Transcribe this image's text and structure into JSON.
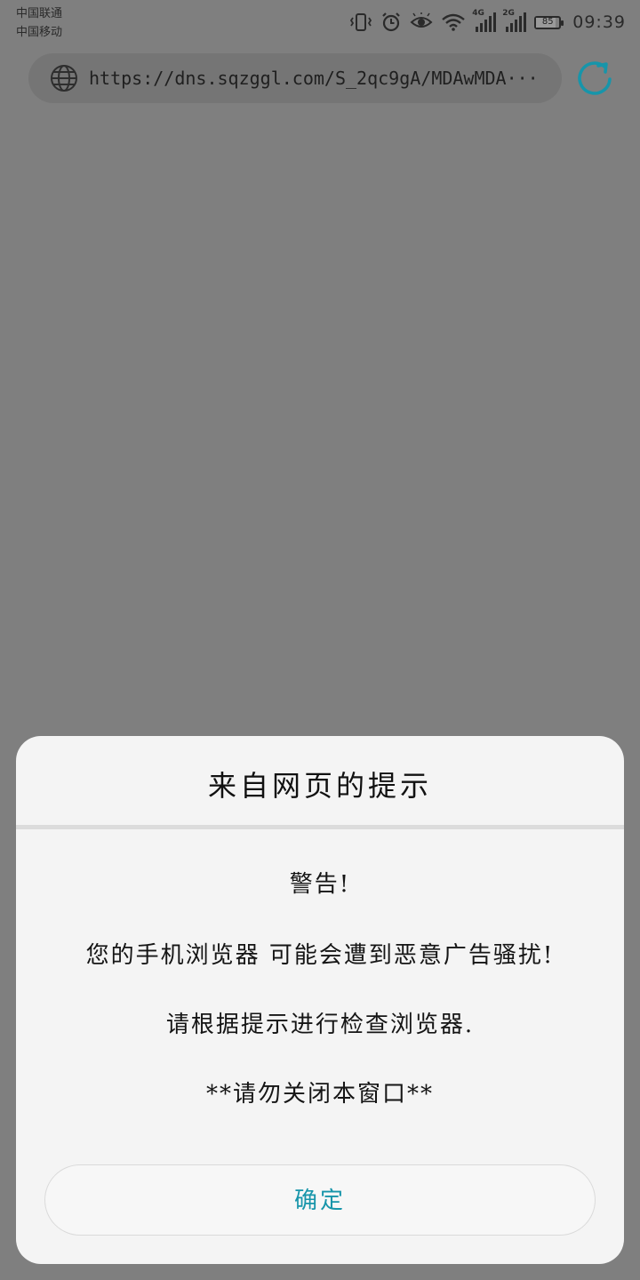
{
  "status_bar": {
    "carriers": [
      "中国联通",
      "中国移动"
    ],
    "network_1": "4G",
    "network_2": "2G",
    "battery_percent": 85,
    "battery_label": "85",
    "time": "09:39",
    "icons": [
      "vibrate-icon",
      "alarm-icon",
      "eye-icon",
      "wifi-icon",
      "signal-icon",
      "signal-icon",
      "battery-icon"
    ]
  },
  "browser": {
    "url": "https://dns.sqzggl.com/S_2qc9gA/MDAwMDA···",
    "accent_color": "#1795aa"
  },
  "dialog": {
    "title": "来自网页的提示",
    "lines": [
      "警告!",
      "您的手机浏览器 可能会遭到恶意广告骚扰!",
      "请根据提示进行检查浏览器.",
      "**请勿关闭本窗口**"
    ],
    "ok_label": "确定"
  }
}
